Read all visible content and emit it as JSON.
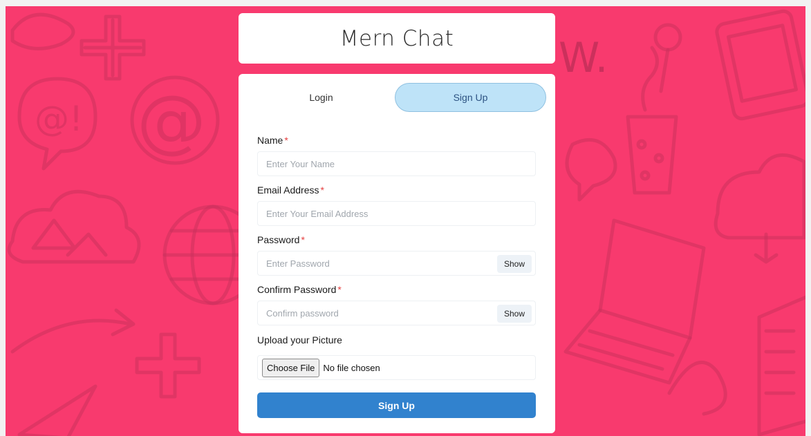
{
  "app": {
    "title": "Mern Chat"
  },
  "tabs": {
    "login": "Login",
    "signup": "Sign Up",
    "active": "signup"
  },
  "form": {
    "name": {
      "label": "Name",
      "required_mark": "*",
      "placeholder": "Enter Your Name",
      "value": ""
    },
    "email": {
      "label": "Email Address",
      "required_mark": "*",
      "placeholder": "Enter Your Email Address",
      "value": ""
    },
    "password": {
      "label": "Password",
      "required_mark": "*",
      "placeholder": "Enter Password",
      "value": "",
      "toggle_label": "Show"
    },
    "confirm_password": {
      "label": "Confirm Password",
      "required_mark": "*",
      "placeholder": "Confirm password",
      "value": "",
      "toggle_label": "Show"
    },
    "picture": {
      "label": "Upload your Picture",
      "button_label": "Choose File",
      "status": "No file chosen"
    },
    "submit_label": "Sign Up"
  },
  "colors": {
    "background": "#f83a6e",
    "active_tab": "#bee3f8",
    "submit_button": "#3182ce",
    "required_mark": "#e53e3e"
  },
  "background_icons": [
    "chat-bubble-icon",
    "at-sign-icon",
    "plus-icon",
    "globe-icon",
    "cloud-icon",
    "coffee-cup-icon",
    "laptop-icon",
    "notebook-icon",
    "tablet-icon",
    "paper-plane-icon",
    "arrow-icon",
    "balloon-icon"
  ]
}
